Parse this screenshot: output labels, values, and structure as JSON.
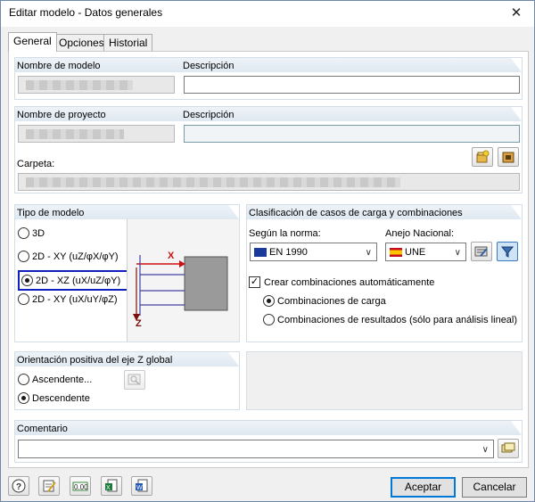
{
  "window": {
    "title": "Editar modelo - Datos generales"
  },
  "tabs": [
    {
      "label": "General",
      "active": true
    },
    {
      "label": "Opciones",
      "active": false
    },
    {
      "label": "Historial",
      "active": false
    }
  ],
  "model": {
    "name_label": "Nombre de modelo",
    "description_label": "Descripción",
    "name_value": "",
    "description_value": ""
  },
  "project": {
    "name_label": "Nombre de proyecto",
    "description_label": "Descripción",
    "folder_label": "Carpeta:"
  },
  "model_type": {
    "title": "Tipo de modelo",
    "options": [
      "3D",
      "2D - XY (uZ/φX/φY)",
      "2D - XZ (uX/uZ/φY)",
      "2D - XY (uX/uY/φZ)"
    ],
    "selected": 2,
    "diagram_x": "X",
    "diagram_z": "Z"
  },
  "classification": {
    "title": "Clasificación de casos de carga y combinaciones",
    "standard_label": "Según la norma:",
    "annex_label": "Anejo Nacional:",
    "standard_value": "EN 1990",
    "annex_value": "UNE",
    "create_combinations": "Crear combinaciones automáticamente",
    "combo_options": [
      "Combinaciones de carga",
      "Combinaciones de resultados (sólo para análisis lineal)"
    ],
    "combo_selected": 0
  },
  "orientation": {
    "title": "Orientación positiva del eje Z global",
    "options": [
      "Ascendente...",
      "Descendente"
    ],
    "selected": 1
  },
  "comment": {
    "title": "Comentario",
    "value": ""
  },
  "buttons": {
    "accept": "Aceptar",
    "cancel": "Cancelar"
  },
  "colors": {
    "accent": "#0078d7",
    "highlight_box": "#1020c0",
    "axis_red": "#d01010"
  }
}
